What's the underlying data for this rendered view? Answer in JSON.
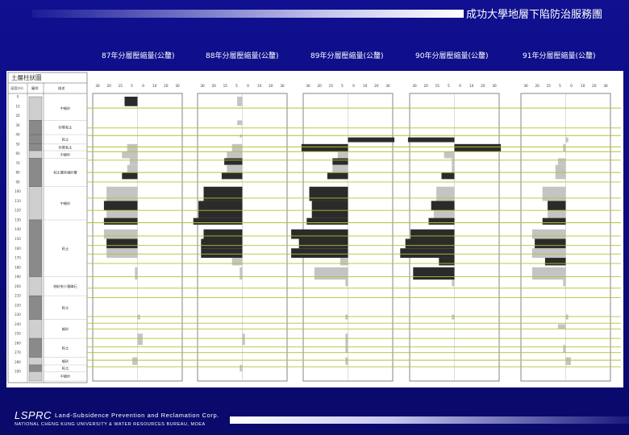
{
  "header": {
    "org_title": "成功大學地層下陷防治服務團"
  },
  "footer": {
    "logo": "LSPRC",
    "company": "Land-Subsidence Prevention and Reclamation Corp.",
    "institution": "NATIONAL CHENG KUNG UNIVERSITY & WATER RESOURCES BUREAU, MOEA"
  },
  "colors": {
    "background": "#10108c",
    "compression": "#2b2b2b",
    "expansion": "#c4c4c4",
    "guide_line": "#b6c02e"
  },
  "log": {
    "title": "土層柱狀圖",
    "header_depth": "深度(m)",
    "header_legend": "圖例",
    "header_desc": "描述",
    "depth_ticks": [
      "0",
      "10",
      "20",
      "30",
      "40",
      "50",
      "60",
      "70",
      "80",
      "90",
      "100",
      "110",
      "120",
      "130",
      "140",
      "150",
      "160",
      "170",
      "180",
      "190",
      "200",
      "210",
      "220",
      "230",
      "240",
      "250",
      "260",
      "270",
      "280",
      "290"
    ],
    "layers": [
      {
        "top": 0,
        "bottom": 25,
        "label": "中細砂"
      },
      {
        "top": 25,
        "bottom": 40,
        "label": "砂質粘土"
      },
      {
        "top": 40,
        "bottom": 50,
        "label": "粘土"
      },
      {
        "top": 50,
        "bottom": 57,
        "label": "砂質粘土"
      },
      {
        "top": 57,
        "bottom": 65,
        "label": "中細砂"
      },
      {
        "top": 65,
        "bottom": 95,
        "label": "粘土層夾細砂層"
      },
      {
        "top": 95,
        "bottom": 130,
        "label": "中細砂"
      },
      {
        "top": 130,
        "bottom": 190,
        "label": "粘土"
      },
      {
        "top": 190,
        "bottom": 210,
        "label": "細砂夾少量礫石"
      },
      {
        "top": 210,
        "bottom": 235,
        "label": "粘土"
      },
      {
        "top": 235,
        "bottom": 255,
        "label": "細砂"
      },
      {
        "top": 255,
        "bottom": 275,
        "label": "粘土"
      },
      {
        "top": 275,
        "bottom": 283,
        "label": "細砂"
      },
      {
        "top": 283,
        "bottom": 290,
        "label": "粘土"
      },
      {
        "top": 290,
        "bottom": 300,
        "label": "中細砂"
      }
    ]
  },
  "chart_data": {
    "type": "bar",
    "orientation": "horizontal",
    "y_axis": "depth (m)",
    "ylim": [
      0,
      300
    ],
    "layer_depths": [
      [
        0,
        10
      ],
      [
        25,
        30
      ],
      [
        40,
        43
      ],
      [
        43,
        48
      ],
      [
        50,
        58
      ],
      [
        58,
        65
      ],
      [
        65,
        72
      ],
      [
        72,
        80
      ],
      [
        80,
        87
      ],
      [
        95,
        110
      ],
      [
        110,
        120
      ],
      [
        120,
        128
      ],
      [
        128,
        135
      ],
      [
        140,
        150
      ],
      [
        150,
        160
      ],
      [
        160,
        170
      ],
      [
        170,
        178
      ],
      [
        180,
        193
      ],
      [
        193,
        200
      ],
      [
        200,
        210
      ],
      [
        210,
        220
      ],
      [
        220,
        230
      ],
      [
        230,
        235
      ],
      [
        235,
        240
      ],
      [
        240,
        245
      ],
      [
        250,
        262
      ],
      [
        262,
        270
      ],
      [
        275,
        283
      ],
      [
        283,
        290
      ]
    ],
    "guide_lines": [
      12,
      33,
      41,
      53,
      58,
      67,
      80,
      90,
      107,
      120,
      133,
      147,
      157,
      166,
      176,
      190,
      202,
      212,
      232,
      239,
      245,
      255,
      264,
      270,
      278,
      285
    ],
    "panels": [
      {
        "title": "87年分層壓縮量(公釐)",
        "ticks": [
          "30",
          "20",
          "15",
          "5",
          "0",
          "10",
          "20",
          "30"
        ],
        "xlim": [
          -30,
          30
        ],
        "values": [
          -5,
          0,
          0,
          0,
          -4,
          -6,
          -3,
          -4,
          -6,
          -12,
          -13,
          -12,
          -13,
          -13,
          -12,
          -12,
          0,
          -1,
          0,
          0,
          0,
          0,
          1,
          0,
          0,
          2,
          0,
          -2,
          0
        ]
      },
      {
        "title": "88年分層壓縮量(公釐)",
        "ticks": [
          "30",
          "20",
          "15",
          "5",
          "0",
          "10",
          "20",
          "30"
        ],
        "xlim": [
          -30,
          30
        ],
        "values": [
          -2,
          -2,
          -1,
          0,
          -4,
          -6,
          -7,
          -6,
          -8,
          -15,
          -17,
          -17,
          -19,
          -15,
          -16,
          -16,
          -4,
          -1,
          0,
          0,
          0,
          0,
          0,
          0,
          0,
          1,
          0,
          0,
          -1
        ]
      },
      {
        "title": "89年分層壓縮量(公釐)",
        "ticks": [
          "30",
          "20",
          "15",
          "5",
          "0",
          "10",
          "20",
          "30"
        ],
        "xlim": [
          -30,
          30
        ],
        "values": [
          0,
          0,
          0,
          18,
          -18,
          -4,
          -6,
          -6,
          -8,
          -15,
          -14,
          -14,
          -16,
          -22,
          -19,
          -22,
          -3,
          -13,
          -1,
          0,
          0,
          0,
          -1,
          0,
          0,
          -1,
          -1,
          -1,
          0
        ]
      },
      {
        "title": "90年分層壓縮量(公釐)",
        "ticks": [
          "30",
          "20",
          "15",
          "5",
          "0",
          "10",
          "20",
          "30"
        ],
        "xlim": [
          -30,
          30
        ],
        "values": [
          0,
          0,
          0,
          -18,
          18,
          -4,
          -1,
          -1,
          -5,
          -7,
          -9,
          -8,
          -10,
          -17,
          -19,
          -21,
          -6,
          -16,
          -1,
          0,
          0,
          0,
          -1,
          0,
          0,
          0,
          0,
          0,
          0
        ]
      },
      {
        "title": "91年分層壓縮量(公釐)",
        "ticks": [
          "30",
          "20",
          "15",
          "5",
          "0",
          "10",
          "20",
          "30"
        ],
        "xlim": [
          -30,
          30
        ],
        "values": [
          0,
          0,
          0,
          1,
          -1,
          0,
          -3,
          -4,
          -4,
          -9,
          -7,
          -7,
          -9,
          -13,
          -12,
          -13,
          -8,
          -13,
          -1,
          0,
          0,
          0,
          1,
          0,
          -3,
          0,
          -1,
          2,
          0
        ]
      }
    ]
  }
}
